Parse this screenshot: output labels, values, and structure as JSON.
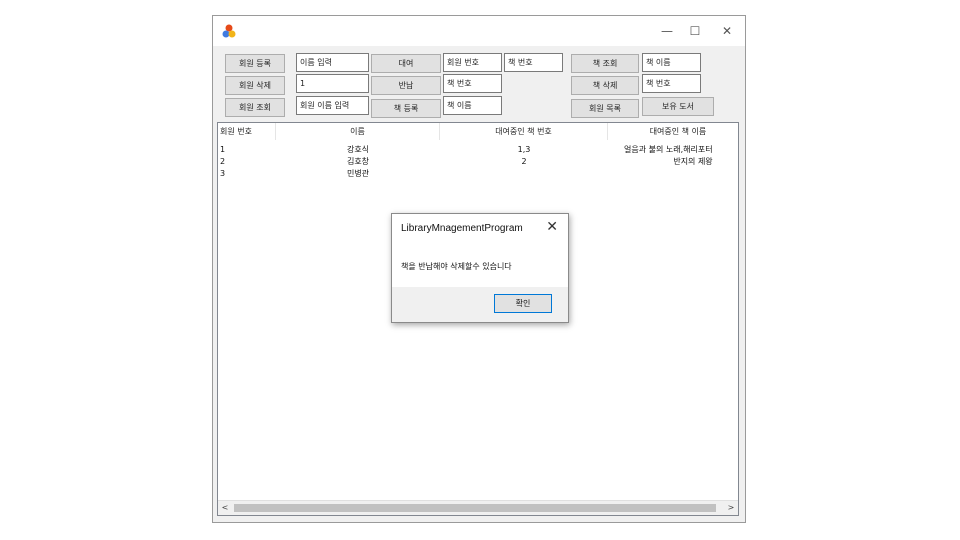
{
  "window": {
    "minimize": "—",
    "maximize": "☐",
    "close": "✕"
  },
  "controls": {
    "register_member": "회원 등록",
    "name_input_value": "이름 입력",
    "lend_button": "대여",
    "member_no_input": "회원 번호",
    "book_no_input": "책 번호",
    "book_search_button": "책 조회",
    "book_name_input": "책 이름",
    "delete_member": "회원 삭제",
    "delete_member_value": "1",
    "return_button": "반납",
    "return_book_no_input": "책 번호",
    "delete_book_button": "책 삭제",
    "delete_book_no_input": "책 번호",
    "search_member": "회원 조회",
    "search_member_name_input": "회원 이름 입력",
    "register_book_button": "책 등록",
    "register_book_name_input": "책 이름",
    "member_list_button": "회원 목록",
    "owned_books_button": "보유 도서"
  },
  "table": {
    "headers": [
      "회원 번호",
      "이름",
      "대여중인 책 번호",
      "대여중인 책 이름"
    ],
    "rows": [
      {
        "no": "1",
        "name": "강호식",
        "book_no": "1,3",
        "book_name": "얼음과 불의 노래,해리포터"
      },
      {
        "no": "2",
        "name": "김호창",
        "book_no": "2",
        "book_name": "반지의 제왕"
      },
      {
        "no": "3",
        "name": "민병관",
        "book_no": "",
        "book_name": ""
      }
    ]
  },
  "scrollbar": {
    "left": "<",
    "right": ">"
  },
  "dialog": {
    "title": "LibraryMnagementProgram",
    "close": "✕",
    "message": "책을 반납해야 삭제할수 있습니다",
    "ok": "확인"
  }
}
